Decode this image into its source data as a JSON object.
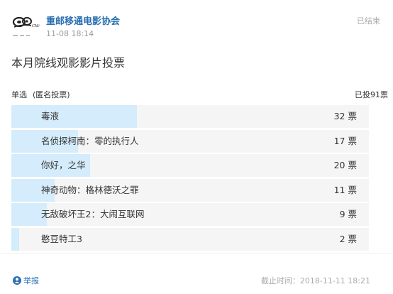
{
  "header": {
    "author": "重邮移通电影协会",
    "timestamp": "11-08 18:14",
    "status": "已结束",
    "logo_text": "重邮移通电影协会"
  },
  "poll": {
    "title": "本月院线观影影片投票",
    "type": "单选",
    "anonymity": "(匿名投票)",
    "total_votes": "已投91票",
    "total_count": 91,
    "options": [
      {
        "label": "毒液",
        "votes_text": "32 票",
        "votes": 32
      },
      {
        "label": "名侦探柯南：零的执行人",
        "votes_text": "17 票",
        "votes": 17
      },
      {
        "label": "你好，之华",
        "votes_text": "20 票",
        "votes": 20
      },
      {
        "label": "神奇动物：格林德沃之罪",
        "votes_text": "11 票",
        "votes": 11
      },
      {
        "label": "无敌破坏王2：大闹互联网",
        "votes_text": "9 票",
        "votes": 9
      },
      {
        "label": "憨豆特工3",
        "votes_text": "2 票",
        "votes": 2
      }
    ]
  },
  "footer": {
    "report_label": "举报",
    "report_icon": "user-icon",
    "deadline": "截止时间：2018-11-11 18:21"
  },
  "colors": {
    "accent": "#2a6fb0",
    "bar_fill": "#d4ecfb",
    "bar_bg": "#f5f5f5",
    "muted": "#999999"
  }
}
